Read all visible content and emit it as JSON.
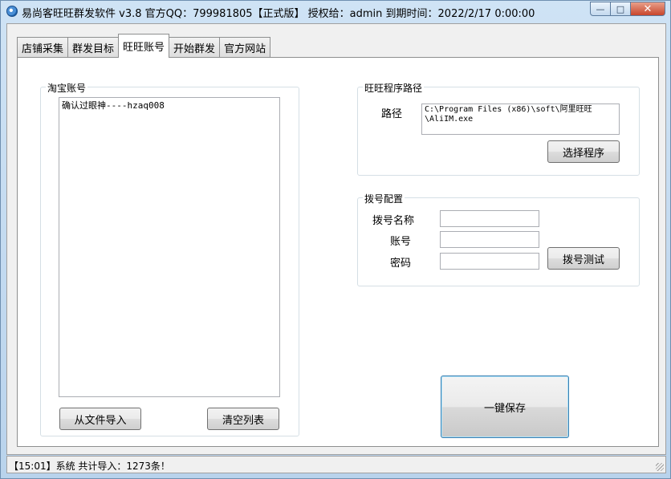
{
  "window": {
    "title": "易尚客旺旺群发软件 v3.8 官方QQ：799981805【正式版】 授权给：admin  到期时间：2022/2/17 0:00:00",
    "min_glyph": "—",
    "max_glyph": "□",
    "close_glyph": "✕",
    "icon": "app-logo-icon"
  },
  "tabs": [
    {
      "label": "店铺采集"
    },
    {
      "label": "群发目标"
    },
    {
      "label": "旺旺账号",
      "active": true
    },
    {
      "label": "开始群发"
    },
    {
      "label": "官方网站"
    }
  ],
  "taobao_accounts": {
    "legend": "淘宝账号",
    "items": [
      "确认过眼神----hzaq008"
    ],
    "import_button": "从文件导入",
    "clear_button": "清空列表"
  },
  "wangwang_path": {
    "legend": "旺旺程序路径",
    "path_label": "路径",
    "path_value": "C:\\Program Files (x86)\\soft\\阿里旺旺\\AliIM.exe",
    "select_button": "选择程序"
  },
  "dialup": {
    "legend": "拨号配置",
    "name_label": "拨号名称",
    "name_value": "",
    "account_label": "账号",
    "account_value": "",
    "password_label": "密码",
    "password_value": "",
    "test_button": "拨号测试"
  },
  "save_button": "一键保存",
  "status": {
    "text": "【15:01】系统 共计导入：1273条！"
  }
}
